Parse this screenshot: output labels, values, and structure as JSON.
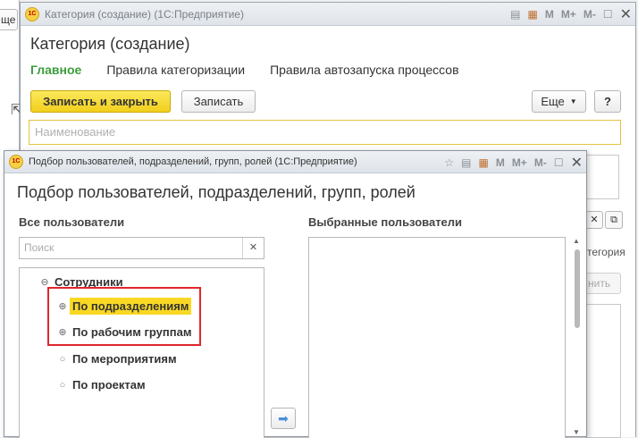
{
  "background_window": {
    "stub_text": "ще"
  },
  "main_window": {
    "title": "Категория (создание)  (1С:Предприятие)",
    "heading": "Категория (создание)",
    "tabs": [
      "Главное",
      "Правила категоризации",
      "Правила автозапуска процессов"
    ],
    "buttons": {
      "save_close": "Записать и закрыть",
      "save": "Записать",
      "more": "Еще",
      "help": "?"
    },
    "name_placeholder": "Наименование",
    "partial_text_1": "тегория",
    "partial_button": "нить"
  },
  "dialog": {
    "title": "Подбор пользователей, подразделений, групп, ролей  (1С:Предприятие)",
    "heading": "Подбор пользователей, подразделений, групп, ролей",
    "all_users_label": "Все пользователи",
    "selected_users_label": "Выбранные пользователи",
    "search_placeholder": "Поиск",
    "tree": {
      "root": "Сотрудники",
      "items": [
        "По подразделениям",
        "По рабочим группам",
        "По мероприятиям",
        "По проектам"
      ]
    }
  },
  "titlebar_icons": [
    "star-icon",
    "list-icon",
    "calendar-icon",
    "M",
    "M+",
    "M-",
    "maximize-icon",
    "close-icon"
  ],
  "colors": {
    "accent_green": "#3c9d3c",
    "primary_yellow": "#f2cf1c",
    "highlight_yellow": "#f9d824",
    "annotation_red": "#e0262b"
  }
}
